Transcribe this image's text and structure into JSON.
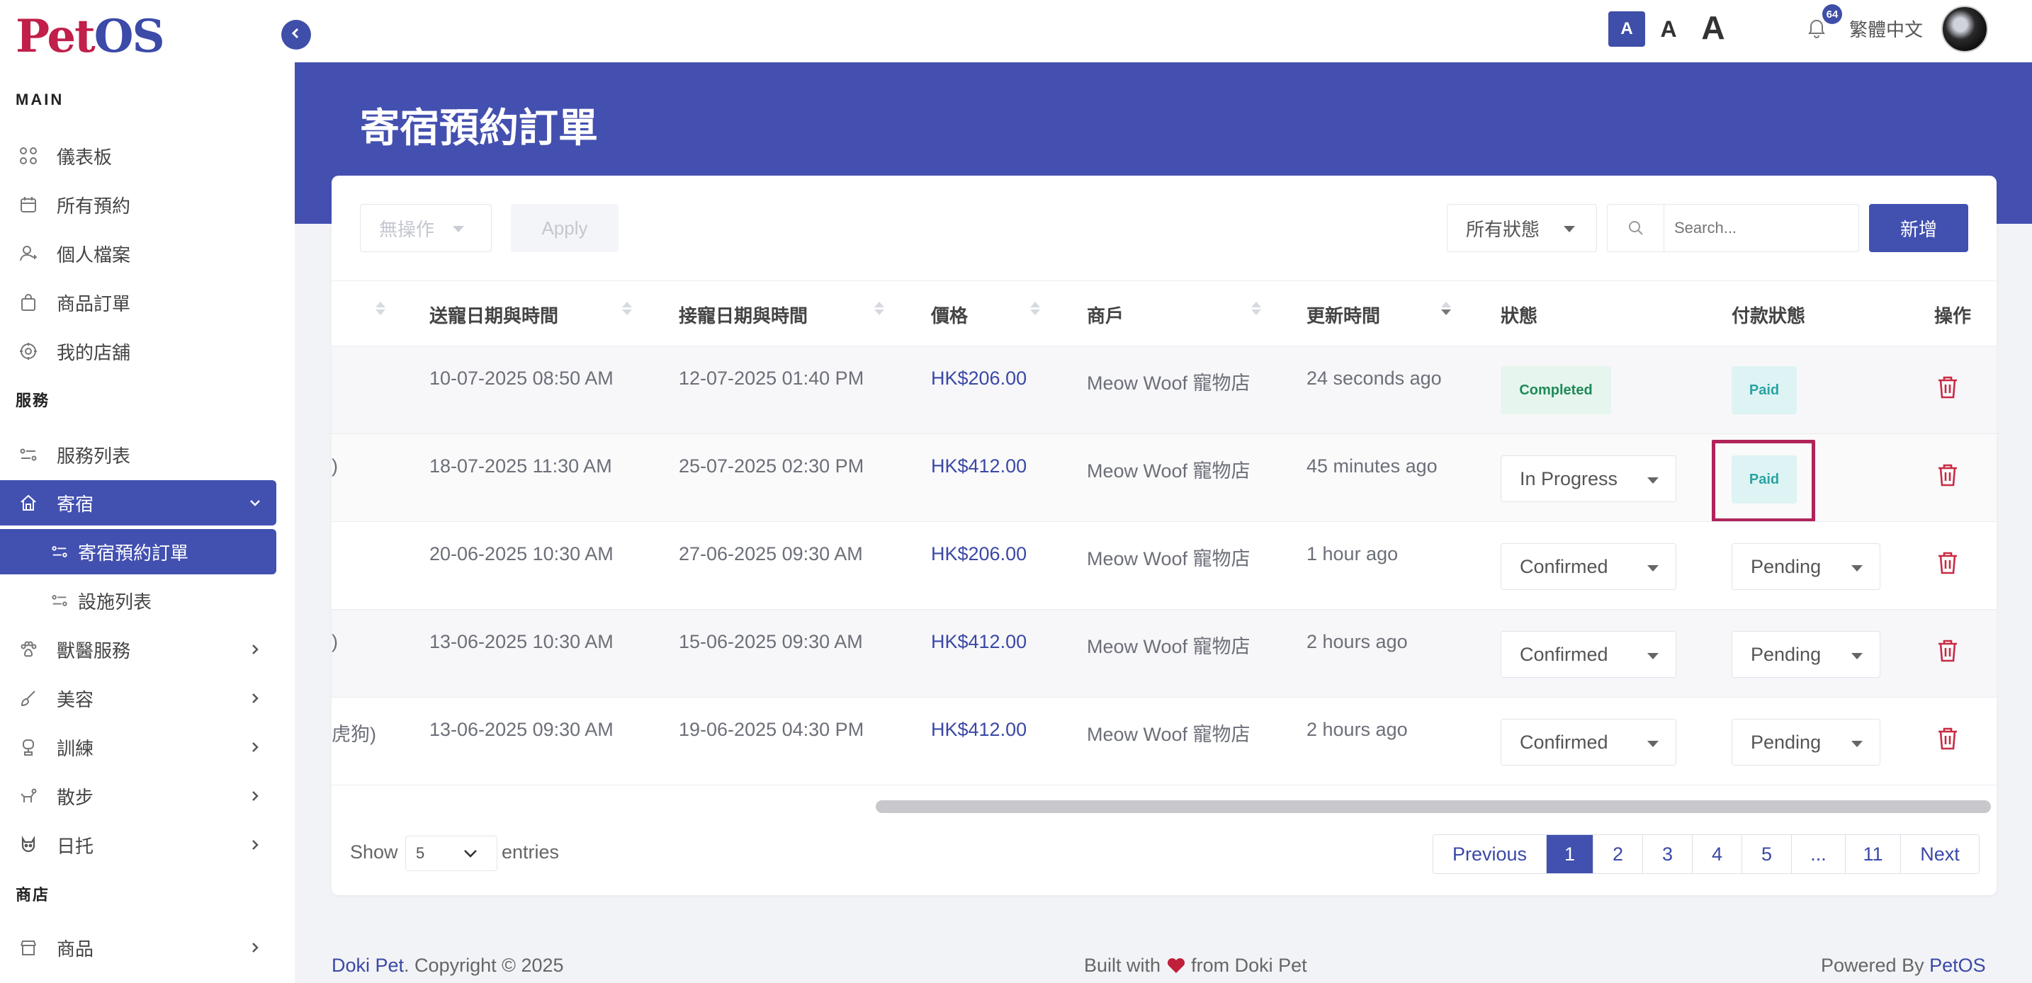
{
  "brand": {
    "logo_part1": "Pet",
    "logo_part2": "OS"
  },
  "sidebar": {
    "sections": {
      "main": "MAIN",
      "services": "服務",
      "shop": "商店"
    },
    "main_items": [
      "儀表板",
      "所有預約",
      "個人檔案",
      "商品訂單",
      "我的店舖"
    ],
    "service_items": {
      "list": "服務列表",
      "boarding": "寄宿",
      "boarding_orders": "寄宿預約訂單",
      "facilities": "設施列表",
      "vet": "獸醫服務",
      "grooming": "美容",
      "training": "訓練",
      "walking": "散步",
      "daycare": "日托"
    },
    "shop_items": {
      "products": "商品"
    }
  },
  "topbar": {
    "font_sizes": [
      "A",
      "A",
      "A"
    ],
    "notifications": "64",
    "language": "繁體中文"
  },
  "page": {
    "title": "寄宿預約訂單"
  },
  "toolbar": {
    "bulk_action": "無操作",
    "apply": "Apply",
    "status_filter": "所有狀態",
    "search_placeholder": "Search...",
    "add": "新增"
  },
  "table": {
    "headers": [
      "送寵日期與時間",
      "接寵日期與時間",
      "價格",
      "商戶",
      "更新時間",
      "狀態",
      "付款狀態",
      "操作"
    ],
    "rows": [
      {
        "partial": "",
        "dropoff": "10-07-2025 08:50 AM",
        "pickup": "12-07-2025 01:40 PM",
        "price": "HK$206.00",
        "merchant": "Meow Woof 寵物店",
        "updated": "24 seconds ago",
        "status": "Completed",
        "payment": "Paid"
      },
      {
        "partial": ")",
        "dropoff": "18-07-2025 11:30 AM",
        "pickup": "25-07-2025 02:30 PM",
        "price": "HK$412.00",
        "merchant": "Meow Woof 寵物店",
        "updated": "45 minutes ago",
        "status": "In Progress",
        "payment": "Paid"
      },
      {
        "partial": "",
        "dropoff": "20-06-2025 10:30 AM",
        "pickup": "27-06-2025 09:30 AM",
        "price": "HK$206.00",
        "merchant": "Meow Woof 寵物店",
        "updated": "1 hour ago",
        "status": "Confirmed",
        "payment": "Pending"
      },
      {
        "partial": ")",
        "dropoff": "13-06-2025 10:30 AM",
        "pickup": "15-06-2025 09:30 AM",
        "price": "HK$412.00",
        "merchant": "Meow Woof 寵物店",
        "updated": "2 hours ago",
        "status": "Confirmed",
        "payment": "Pending"
      },
      {
        "partial": "虎狗)",
        "dropoff": "13-06-2025 09:30 AM",
        "pickup": "19-06-2025 04:30 PM",
        "price": "HK$412.00",
        "merchant": "Meow Woof 寵物店",
        "updated": "2 hours ago",
        "status": "Confirmed",
        "payment": "Pending"
      }
    ]
  },
  "footer_controls": {
    "show": "Show",
    "entries_value": "5",
    "entries": "entries",
    "pagination": [
      "Previous",
      "1",
      "2",
      "3",
      "4",
      "5",
      "...",
      "11",
      "Next"
    ]
  },
  "footer": {
    "company": "Doki Pet",
    "copyright": ". Copyright © 2025",
    "built_with": "Built with",
    "from": "from Doki Pet",
    "powered_by": "Powered By ",
    "powered_brand": "PetOS"
  },
  "colors": {
    "primary": "#4250b0",
    "danger": "#c92a44",
    "highlight": "#b0245a",
    "paid": "#2aa3a3",
    "completed": "#1f8a57"
  }
}
